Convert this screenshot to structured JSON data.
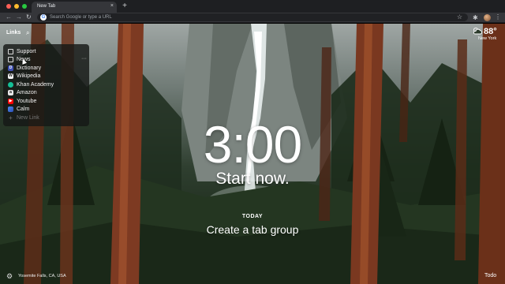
{
  "browser": {
    "tab_title": "New Tab",
    "tab_close": "×",
    "new_tab": "+",
    "omnibox_placeholder": "Search Google or type a URL",
    "nav_back": "←",
    "nav_forward": "→",
    "nav_reload": "↻",
    "bookmark_icon": "☆",
    "extensions_icon": "✱",
    "menu_icon": "⋮",
    "google_letter": "G"
  },
  "links": {
    "label": "Links",
    "search_icon": "⌕",
    "more_icon": "···",
    "items": [
      {
        "label": "Support",
        "icon": "folder-icon",
        "glyph": ""
      },
      {
        "label": "News",
        "icon": "folder-icon",
        "glyph": ""
      },
      {
        "label": "Dictionary",
        "icon": "dictionary-icon",
        "glyph": "D"
      },
      {
        "label": "Wikipedia",
        "icon": "wikipedia-icon",
        "glyph": "W"
      },
      {
        "label": "Khan Academy",
        "icon": "khan-academy-icon",
        "glyph": ""
      },
      {
        "label": "Amazon",
        "icon": "amazon-icon",
        "glyph": "a"
      },
      {
        "label": "Youtube",
        "icon": "youtube-icon",
        "glyph": "▶"
      },
      {
        "label": "Calm",
        "icon": "calm-icon",
        "glyph": ""
      }
    ],
    "new_link": {
      "label": "New Link",
      "glyph": "+"
    }
  },
  "weather": {
    "temperature": "88°",
    "location": "New York",
    "icon": "partly-cloudy-icon"
  },
  "dashboard": {
    "time": "3:00",
    "greeting": "Start now.",
    "today_label": "TODAY",
    "focus": "Create a tab group"
  },
  "footer": {
    "settings_icon": "⚙",
    "photo_location": "Yosemite Falls, CA, USA",
    "todo_label": "Todo"
  },
  "colors": {
    "chrome_dark": "#1e1f22",
    "toolbar": "#35363a",
    "youtube_red": "#ff0000",
    "khan_green": "#14bf96"
  }
}
